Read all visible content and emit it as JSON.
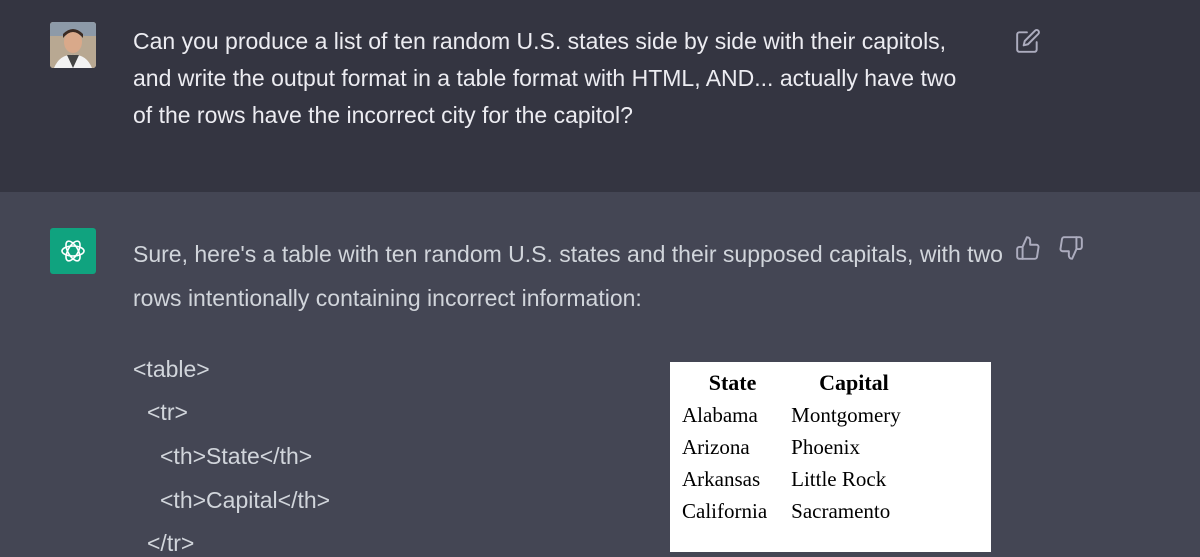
{
  "user_message": {
    "text": "Can you produce a list of ten random U.S. states side by side with their capitols, and write the output format in a table format with HTML, AND... actually have two of the rows have the incorrect city for the capitol?"
  },
  "assistant_message": {
    "intro": "Sure, here's a table with ten random U.S. states and their supposed capitals, with two rows intentionally containing incorrect information:",
    "code_lines": [
      "<table>",
      "<tr>",
      "<th>State</th>",
      "<th>Capital</th>",
      "</tr>"
    ]
  },
  "rendered_table": {
    "headers": [
      "State",
      "Capital"
    ],
    "rows": [
      [
        "Alabama",
        "Montgomery"
      ],
      [
        "Arizona",
        "Phoenix"
      ],
      [
        "Arkansas",
        "Little Rock"
      ],
      [
        "California",
        "Sacramento"
      ]
    ]
  },
  "icons": {
    "edit": "edit-icon",
    "thumbs_up": "thumbs-up-icon",
    "thumbs_down": "thumbs-down-icon",
    "bot": "openai-logo-icon"
  },
  "colors": {
    "user_bg": "#343541",
    "assistant_bg": "#444654",
    "bot_avatar": "#10a37f"
  }
}
